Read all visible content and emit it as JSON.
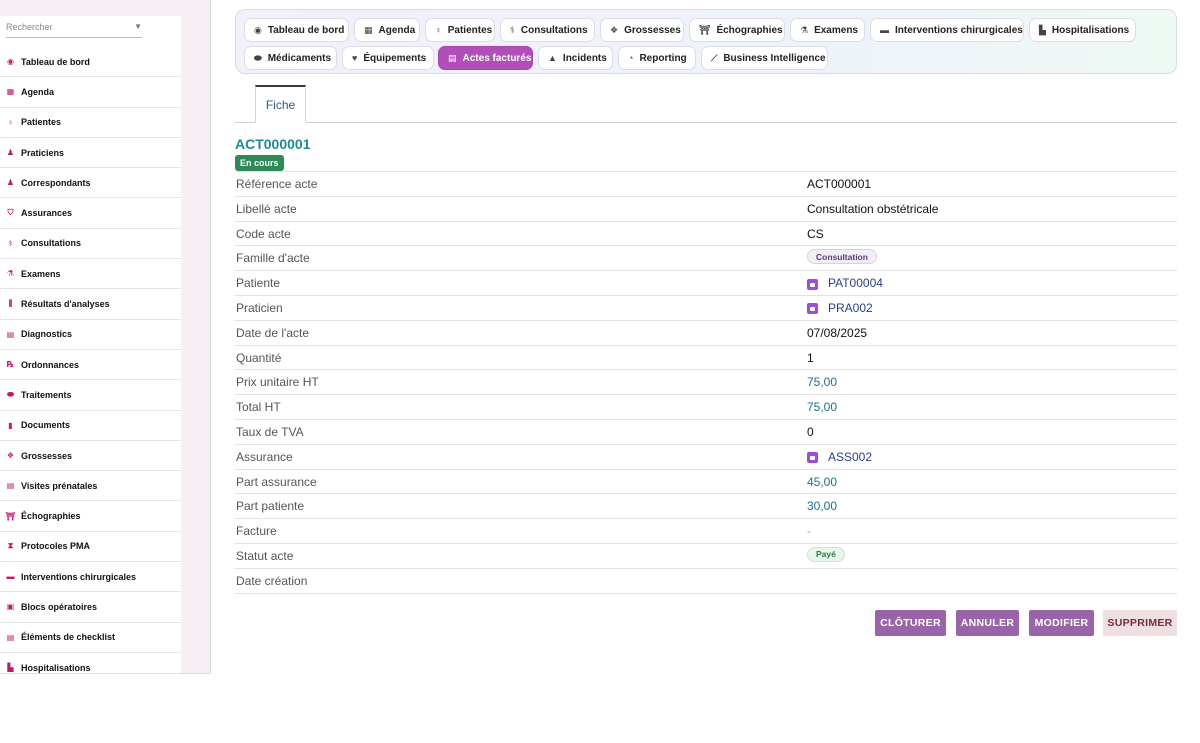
{
  "sidebar": {
    "search_placeholder": "Rechercher",
    "items": [
      {
        "label": "Tableau de bord",
        "icon": "dashboard-icon",
        "glyph": "◉"
      },
      {
        "label": "Agenda",
        "icon": "calendar-icon",
        "glyph": "▦"
      },
      {
        "label": "Patientes",
        "icon": "female-icon",
        "glyph": "♀"
      },
      {
        "label": "Praticiens",
        "icon": "user-doctor-icon",
        "glyph": "♟"
      },
      {
        "label": "Correspondants",
        "icon": "user-icon",
        "glyph": "♟"
      },
      {
        "label": "Assurances",
        "icon": "shield-icon",
        "glyph": "⛉"
      },
      {
        "label": "Consultations",
        "icon": "stethoscope-icon",
        "glyph": "⚕"
      },
      {
        "label": "Examens",
        "icon": "microscope-icon",
        "glyph": "⚗"
      },
      {
        "label": "Résultats d'analyses",
        "icon": "vials-icon",
        "glyph": "⫼"
      },
      {
        "label": "Diagnostics",
        "icon": "clipboard-icon",
        "glyph": "▤"
      },
      {
        "label": "Ordonnances",
        "icon": "prescription-icon",
        "glyph": "℞"
      },
      {
        "label": "Traitements",
        "icon": "pills-icon",
        "glyph": "⬬"
      },
      {
        "label": "Documents",
        "icon": "file-icon",
        "glyph": "▮"
      },
      {
        "label": "Grossesses",
        "icon": "baby-icon",
        "glyph": "❖"
      },
      {
        "label": "Visites prénatales",
        "icon": "clipboard-check-icon",
        "glyph": "▤"
      },
      {
        "label": "Échographies",
        "icon": "ultrasound-icon",
        "glyph": "⛩"
      },
      {
        "label": "Protocoles PMA",
        "icon": "dna-icon",
        "glyph": "⧗"
      },
      {
        "label": "Interventions chirurgicales",
        "icon": "bed-icon",
        "glyph": "▬"
      },
      {
        "label": "Blocs opératoires",
        "icon": "hospital-icon",
        "glyph": "▣"
      },
      {
        "label": "Éléments de checklist",
        "icon": "checklist-icon",
        "glyph": "▤"
      },
      {
        "label": "Hospitalisations",
        "icon": "hospital-user-icon",
        "glyph": "▙"
      }
    ]
  },
  "topnav": [
    {
      "label": "Tableau de bord",
      "icon": "dashboard-icon",
      "glyph": "◉",
      "active": false
    },
    {
      "label": "Agenda",
      "icon": "calendar-icon",
      "glyph": "▦",
      "active": false
    },
    {
      "label": "Patientes",
      "icon": "female-icon",
      "glyph": "♀",
      "active": false
    },
    {
      "label": "Consultations",
      "icon": "stethoscope-icon",
      "glyph": "⚕",
      "active": false
    },
    {
      "label": "Grossesses",
      "icon": "baby-icon",
      "glyph": "❖",
      "active": false
    },
    {
      "label": "Échographies",
      "icon": "ultrasound-icon",
      "glyph": "⛩",
      "active": false
    },
    {
      "label": "Examens",
      "icon": "microscope-icon",
      "glyph": "⚗",
      "active": false
    },
    {
      "label": "Interventions chirurgicales",
      "icon": "bed-icon",
      "glyph": "▬",
      "active": false
    },
    {
      "label": "Hospitalisations",
      "icon": "hospital-user-icon",
      "glyph": "▙",
      "active": false
    },
    {
      "label": "Médicaments",
      "icon": "pills-icon",
      "glyph": "⬬",
      "active": false
    },
    {
      "label": "Équipements",
      "icon": "heart-icon",
      "glyph": "♥",
      "active": false
    },
    {
      "label": "Actes facturés",
      "icon": "invoice-icon",
      "glyph": "▤",
      "active": true
    },
    {
      "label": "Incidents",
      "icon": "warning-icon",
      "glyph": "▲",
      "active": false
    },
    {
      "label": "Reporting",
      "icon": "pie-chart-icon",
      "glyph": "◔",
      "active": false
    },
    {
      "label": "Business Intelligence",
      "icon": "line-chart-icon",
      "glyph": "⟋",
      "active": false
    }
  ],
  "tabs": {
    "fiche": "Fiche"
  },
  "record": {
    "title": "ACT000001",
    "status": "En cours",
    "fields": [
      {
        "label": "Référence acte",
        "value": "ACT000001",
        "kind": "text"
      },
      {
        "label": "Libellé acte",
        "value": "Consultation obstétricale",
        "kind": "text"
      },
      {
        "label": "Code acte",
        "value": "CS",
        "kind": "text"
      },
      {
        "label": "Famille d'acte",
        "value": "Consultation",
        "kind": "pill-family"
      },
      {
        "label": "Patiente",
        "value": "PAT00004",
        "kind": "link"
      },
      {
        "label": "Praticien",
        "value": "PRA002",
        "kind": "link"
      },
      {
        "label": "Date de l'acte",
        "value": "07/08/2025",
        "kind": "text"
      },
      {
        "label": "Quantité",
        "value": "1",
        "kind": "text"
      },
      {
        "label": "Prix unitaire HT",
        "value": "75,00",
        "kind": "money"
      },
      {
        "label": "Total HT",
        "value": "75,00",
        "kind": "money"
      },
      {
        "label": "Taux de TVA",
        "value": "0",
        "kind": "text"
      },
      {
        "label": "Assurance",
        "value": "ASS002",
        "kind": "link"
      },
      {
        "label": "Part assurance",
        "value": "45,00",
        "kind": "money"
      },
      {
        "label": "Part patiente",
        "value": "30,00",
        "kind": "money"
      },
      {
        "label": "Facture",
        "value": "-",
        "kind": "dash"
      },
      {
        "label": "Statut acte",
        "value": "Payé",
        "kind": "pill-paid"
      },
      {
        "label": "Date création",
        "value": "",
        "kind": "text"
      }
    ]
  },
  "actions": {
    "cloturer": "CLÔTURER",
    "annuler": "ANNULER",
    "modifier": "MODIFIER",
    "supprimer": "SUPPRIMER"
  }
}
